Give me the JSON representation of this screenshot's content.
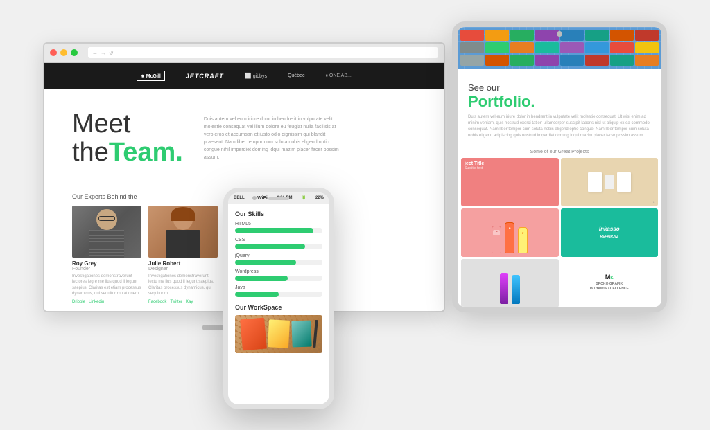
{
  "scene": {
    "background": "#f0f0f0"
  },
  "desktop": {
    "titlebar": {
      "dots": [
        "red",
        "yellow",
        "green"
      ],
      "nav_arrows": [
        "←",
        "→",
        "↺"
      ]
    },
    "nav": {
      "brands": [
        "McGill",
        "JETCRAFT",
        "gibbys",
        "Québec",
        "ONE AB"
      ]
    },
    "hero": {
      "line1": "Meet",
      "line2": "the",
      "accent": "Team.",
      "body_text": "Duis autem vel eum iriure dolor in hendrerit in vulputate velit molestie consequat vel illum dolore eu feugiat nulla facilisis at vero eros et accumsan et iusto odio dignissim qui blandit praesent. Nam liber tempor cum soluta nobis eligend optio congue nihil imperdiet doming idqui mazim placer facer possim assum."
    },
    "team": {
      "label": "Our Experts Behind the",
      "members": [
        {
          "name": "Roy Grey",
          "role": "Founder",
          "desc": "Investigationes demonstraverunt lectores legre me lius quod ii legunt saepius. Claritas est etiam processus dynamicus, qui sequitur mutationem",
          "links": [
            "Dribble",
            "Linkedin"
          ]
        },
        {
          "name": "Julie Robert",
          "role": "Designer",
          "desc": "Investigationes demonstraverunt lectu me lius quod ii legunt saepius. Claritas processus dynamicus, qui sequitur m",
          "links": [
            "Facebook",
            "Twitter",
            "Kay"
          ]
        }
      ]
    }
  },
  "tablet": {
    "camera": true,
    "hero": {
      "see_our": "See our",
      "portfolio": "Portfolio.",
      "body_text": "Duis autem vel eum iriure dolor in hendrerit in vulputate velit molestie consequat. Ut wisi enim ad minim veniam, quis nostrud exerci tation ullamcorper suscipit laboris nisl ut aliquip ex ea commodo consequat. Nam liber tempor cum soluta nobis eligend optio congue. Nam liber tempor cum soluta nobis eligend adipiscing quis nostrud imperdiet doming idqui mazim placer facer possim assum."
    },
    "portfolio": {
      "label": "Some of our Great Projects",
      "items": [
        {
          "id": 1,
          "color": "#f08080",
          "title": "ject Title",
          "subtitle": "Subtitle text"
        },
        {
          "id": 2,
          "color": "#e8d5b0",
          "title": "",
          "subtitle": ""
        },
        {
          "id": 3,
          "color": "#f5a0a0",
          "title": "",
          "subtitle": ""
        },
        {
          "id": 4,
          "color": "#1abc9c",
          "title": "",
          "subtitle": ""
        },
        {
          "id": 5,
          "color": "#e8e8e8",
          "title": "",
          "subtitle": ""
        },
        {
          "id": 6,
          "color": "#a0d0d0",
          "title": "",
          "subtitle": ""
        }
      ]
    }
  },
  "phone": {
    "status_bar": {
      "carrier": "BELL",
      "time": "4:21 PM",
      "battery": "22%"
    },
    "skills": {
      "title": "Our Skills",
      "items": [
        {
          "label": "HTML5",
          "percent": 90
        },
        {
          "label": "CSS",
          "percent": 80
        },
        {
          "label": "jQuery",
          "percent": 70
        },
        {
          "label": "Wordpress",
          "percent": 60
        },
        {
          "label": "Java",
          "percent": 50
        }
      ]
    },
    "workspace": {
      "title": "Our WorkSpace"
    }
  }
}
